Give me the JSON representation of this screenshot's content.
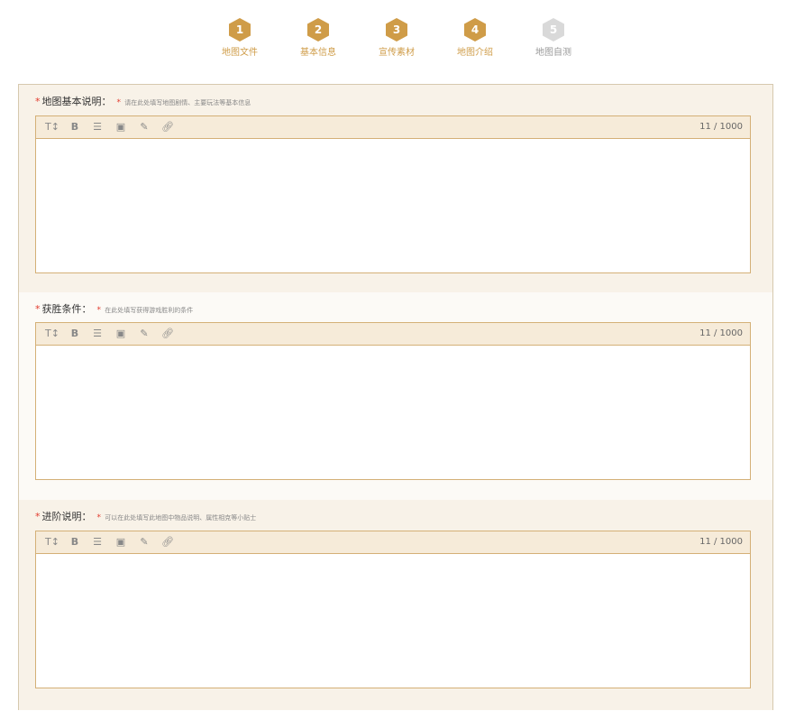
{
  "stepper": {
    "steps": [
      {
        "num": "1",
        "label": "地图文件",
        "state": "done"
      },
      {
        "num": "2",
        "label": "基本信息",
        "state": "done"
      },
      {
        "num": "3",
        "label": "宣传素材",
        "state": "done"
      },
      {
        "num": "4",
        "label": "地图介绍",
        "state": "done"
      },
      {
        "num": "5",
        "label": "地图自测",
        "state": "todo"
      }
    ]
  },
  "sections": [
    {
      "required": "*",
      "title": "地图基本说明：",
      "hint_star": "*",
      "hint": "请在此处填写地图剧情、主要玩法等基本信息",
      "counter": "11 / 1000"
    },
    {
      "required": "*",
      "title": "获胜条件：",
      "hint_star": "*",
      "hint": "在此处填写获得游戏胜利的条件",
      "counter": "11 / 1000"
    },
    {
      "required": "*",
      "title": "进阶说明：",
      "hint_star": "*",
      "hint": "可以在此处填写此地图中物品说明、属性相克等小贴士",
      "counter": "11 / 1000"
    }
  ],
  "toolbar_icons": [
    "text-size-icon",
    "bold-icon",
    "align-icon",
    "image-icon",
    "pen-icon",
    "link-icon"
  ],
  "colors": {
    "accent": "#cf9c48",
    "step_inactive": "#d9d9d9",
    "panel_bg": "#f8f2e8",
    "editor_border": "#d4b077",
    "required": "#e23b2e"
  }
}
